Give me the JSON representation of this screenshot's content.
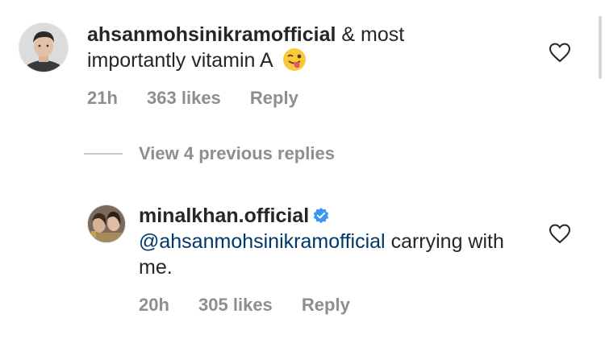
{
  "comments": [
    {
      "username": "ahsanmohsinikramofficial",
      "text": "& most importantly vitamin A",
      "emoji": "winking-face-with-tongue",
      "time": "21h",
      "likes": "363 likes",
      "reply_label": "Reply"
    },
    {
      "username": "minalkhan.official",
      "verified": true,
      "mention": "@ahsanmohsinikramofficial",
      "text": "carrying with me.",
      "time": "20h",
      "likes": "305 likes",
      "reply_label": "Reply"
    }
  ],
  "view_replies_label": "View 4 previous replies",
  "icons": {
    "like": "heart-outline-icon",
    "verified": "verified-badge-icon"
  },
  "colors": {
    "text": "#262626",
    "muted": "#8e8e8e",
    "mention": "#00376b",
    "verified": "#3897f0"
  }
}
